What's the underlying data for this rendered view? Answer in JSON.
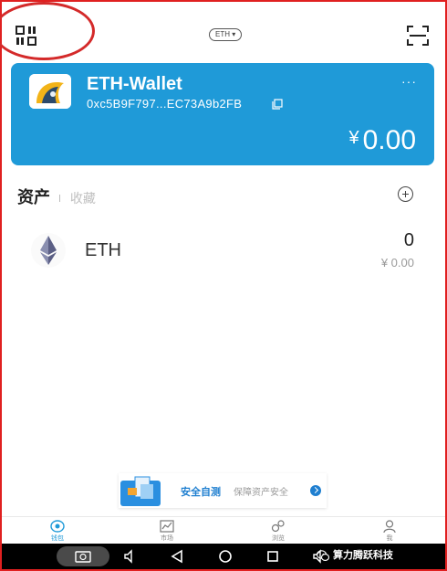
{
  "header": {
    "network_chip": "ETH",
    "menu_icon": "grid-menu-icon",
    "scan_icon": "scan-icon"
  },
  "wallet": {
    "name": "ETH-Wallet",
    "address": "0xc5B9F797...EC73A9b2FB",
    "more": "···",
    "currency_symbol": "¥",
    "balance": "0.00",
    "card_color": "#1f9ad8"
  },
  "assets": {
    "tab_assets": "资产",
    "tab_favorites": "收藏",
    "items": [
      {
        "name": "ETH",
        "amount": "0",
        "fiat": "¥ 0.00",
        "icon": "ethereum-icon"
      }
    ]
  },
  "banner": {
    "title": "安全自测",
    "subtitle": "保障资产安全"
  },
  "nav": {
    "items": [
      {
        "label": "钱包",
        "icon": "wallet-icon"
      },
      {
        "label": "市场",
        "icon": "chart-icon"
      },
      {
        "label": "浏览",
        "icon": "discover-icon"
      },
      {
        "label": "我",
        "icon": "profile-icon"
      }
    ]
  },
  "watermark": "算力腾跃科技"
}
